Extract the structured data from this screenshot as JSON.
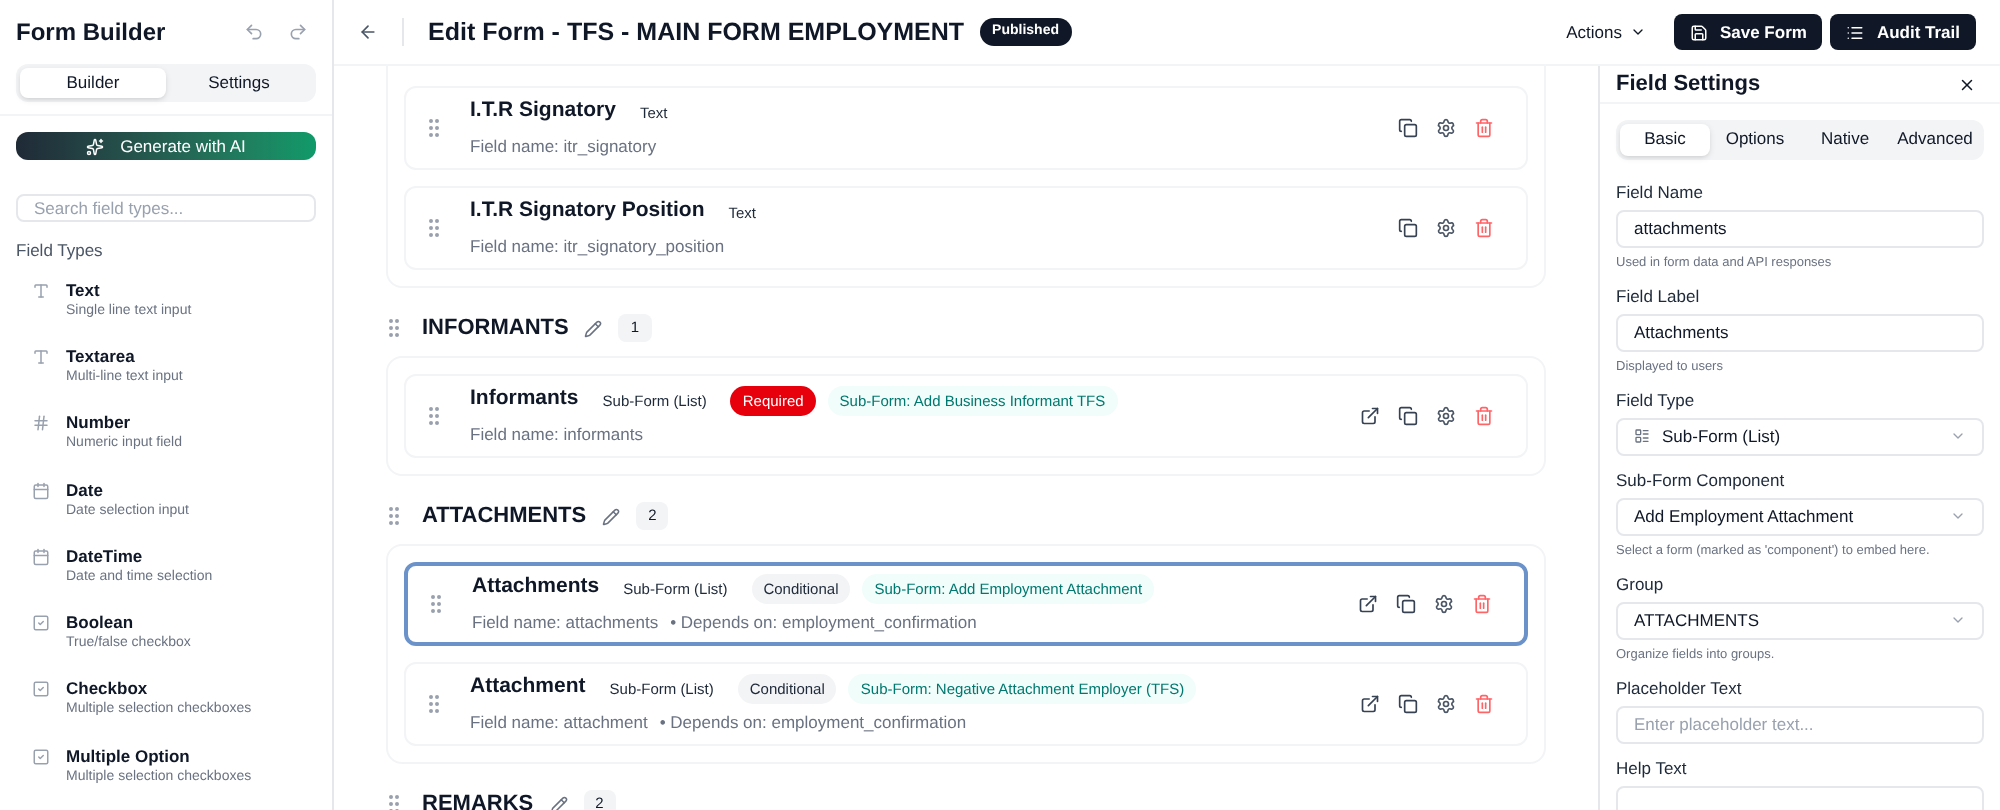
{
  "sidebar": {
    "title": "Form Builder",
    "tabs": [
      {
        "label": "Builder",
        "selected": true
      },
      {
        "label": "Settings",
        "selected": false
      }
    ],
    "generate_button": "Generate with AI",
    "search": {
      "placeholder": "Search field types..."
    },
    "section_title": "Field Types",
    "field_types": [
      {
        "kind": "text",
        "label": "Text",
        "description": "Single line text input"
      },
      {
        "kind": "text",
        "label": "Textarea",
        "description": "Multi-line text input"
      },
      {
        "kind": "number",
        "label": "Number",
        "description": "Numeric input field"
      },
      {
        "kind": "date",
        "label": "Date",
        "description": "Date selection input"
      },
      {
        "kind": "date",
        "label": "DateTime",
        "description": "Date and time selection"
      },
      {
        "kind": "check",
        "label": "Boolean",
        "description": "True/false checkbox"
      },
      {
        "kind": "check",
        "label": "Checkbox",
        "description": "Multiple selection checkboxes"
      },
      {
        "kind": "check",
        "label": "Multiple Option",
        "description": "Multiple selection checkboxes"
      }
    ]
  },
  "header": {
    "title": "Edit Form - TFS - MAIN FORM EMPLOYMENT",
    "status": "Published",
    "actions_button": "Actions",
    "save_button": "Save Form",
    "audit_button": "Audit Trail"
  },
  "groups": [
    {
      "fields": [
        {
          "label": "I.T.R Signatory",
          "selected": false,
          "badges": [
            {
              "kind": "type",
              "text": "Text"
            }
          ],
          "field_name": "Field name: itr_signatory",
          "linked": false
        },
        {
          "label": "I.T.R Signatory Position",
          "selected": false,
          "badges": [
            {
              "kind": "type",
              "text": "Text"
            }
          ],
          "field_name": "Field name: itr_signatory_position",
          "linked": false
        }
      ]
    },
    {
      "title": "INFORMANTS",
      "count": "1",
      "fields": [
        {
          "label": "Informants",
          "selected": false,
          "badges": [
            {
              "kind": "type",
              "text": "Sub-Form (List)"
            },
            {
              "kind": "required",
              "text": "Required"
            },
            {
              "kind": "subform",
              "text": "Sub-Form: Add Business Informant TFS"
            }
          ],
          "field_name": "Field name: informants",
          "linked": true
        }
      ]
    },
    {
      "title": "ATTACHMENTS",
      "count": "2",
      "fields": [
        {
          "label": "Attachments",
          "selected": true,
          "badges": [
            {
              "kind": "type",
              "text": "Sub-Form (List)"
            },
            {
              "kind": "conditional",
              "text": "Conditional"
            },
            {
              "kind": "subform",
              "text": "Sub-Form: Add Employment Attachment"
            }
          ],
          "field_name": "Field name: attachments",
          "depends": "• Depends on: employment_confirmation",
          "linked": true
        },
        {
          "label": "Attachment",
          "selected": false,
          "badges": [
            {
              "kind": "type",
              "text": "Sub-Form (List)"
            },
            {
              "kind": "conditional",
              "text": "Conditional"
            },
            {
              "kind": "subform",
              "text": "Sub-Form: Negative Attachment Employer (TFS)"
            }
          ],
          "field_name": "Field name: attachment",
          "depends": "• Depends on: employment_confirmation",
          "linked": true
        }
      ]
    },
    {
      "title": "REMARKS",
      "count": "2"
    }
  ],
  "settings": {
    "title": "Field Settings",
    "tabs": [
      {
        "label": "Basic",
        "selected": true
      },
      {
        "label": "Options",
        "selected": false
      },
      {
        "label": "Native",
        "selected": false
      },
      {
        "label": "Advanced",
        "selected": false
      }
    ],
    "fields": [
      {
        "kind": "input",
        "label": "Field Name",
        "value": "attachments",
        "help": "Used in form data and API responses"
      },
      {
        "kind": "input",
        "label": "Field Label",
        "value": "Attachments",
        "help": "Displayed to users"
      },
      {
        "kind": "select",
        "label": "Field Type",
        "value": "Sub-Form (List)",
        "icon": true
      },
      {
        "kind": "select",
        "label": "Sub-Form Component",
        "value": "Add Employment Attachment",
        "help": "Select a form (marked as 'component') to embed here."
      },
      {
        "kind": "select",
        "label": "Group",
        "value": "ATTACHMENTS",
        "help": "Organize fields into groups."
      },
      {
        "kind": "input",
        "label": "Placeholder Text",
        "placeholder": "Enter placeholder text..."
      },
      {
        "kind": "input",
        "label": "Help Text"
      }
    ]
  }
}
